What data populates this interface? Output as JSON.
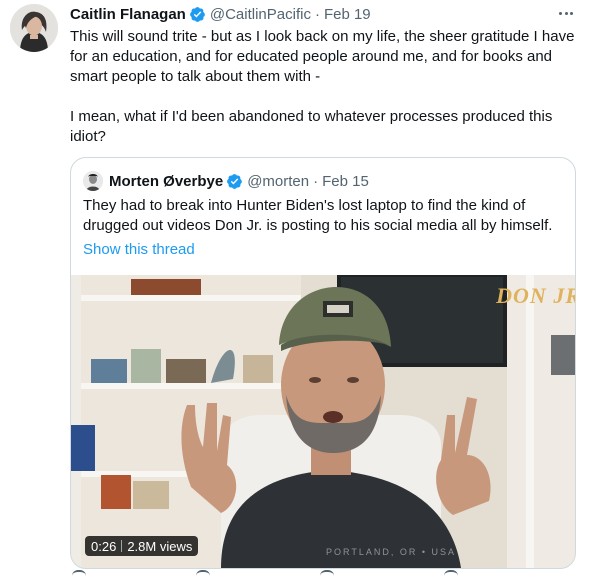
{
  "author": {
    "name": "Caitlin Flanagan",
    "handle": "@CaitlinPacific",
    "separator": "·",
    "date": "Feb 19"
  },
  "tweet": {
    "paragraph_1": "This will sound trite - but as I look back on my life, the sheer gratitude I have for an education, and for educated people around me, and for books and smart people to talk about them with -",
    "paragraph_2": "I mean, what if I'd been abandoned to whatever processes produced this idiot?"
  },
  "quoted": {
    "name": "Morten Øverbye",
    "handle": "@morten",
    "separator": "·",
    "date": "Feb 15",
    "text": "They had to break into Hunter Biden's lost laptop to find the kind of drugged out videos Don Jr. is posting to his social media all by himself.",
    "thread_link": "Show this thread",
    "video": {
      "duration": "0:26",
      "views": "2.8M views",
      "watermark": "DON JR",
      "shirt_text": "PORTLAND, OR • USA"
    }
  },
  "icons": {
    "verified": "verified-badge-icon",
    "more": "more-options-icon"
  },
  "colors": {
    "accent": "#1d9bf0",
    "text": "#0f1419",
    "secondary": "#536471",
    "border": "#cfd9de"
  }
}
